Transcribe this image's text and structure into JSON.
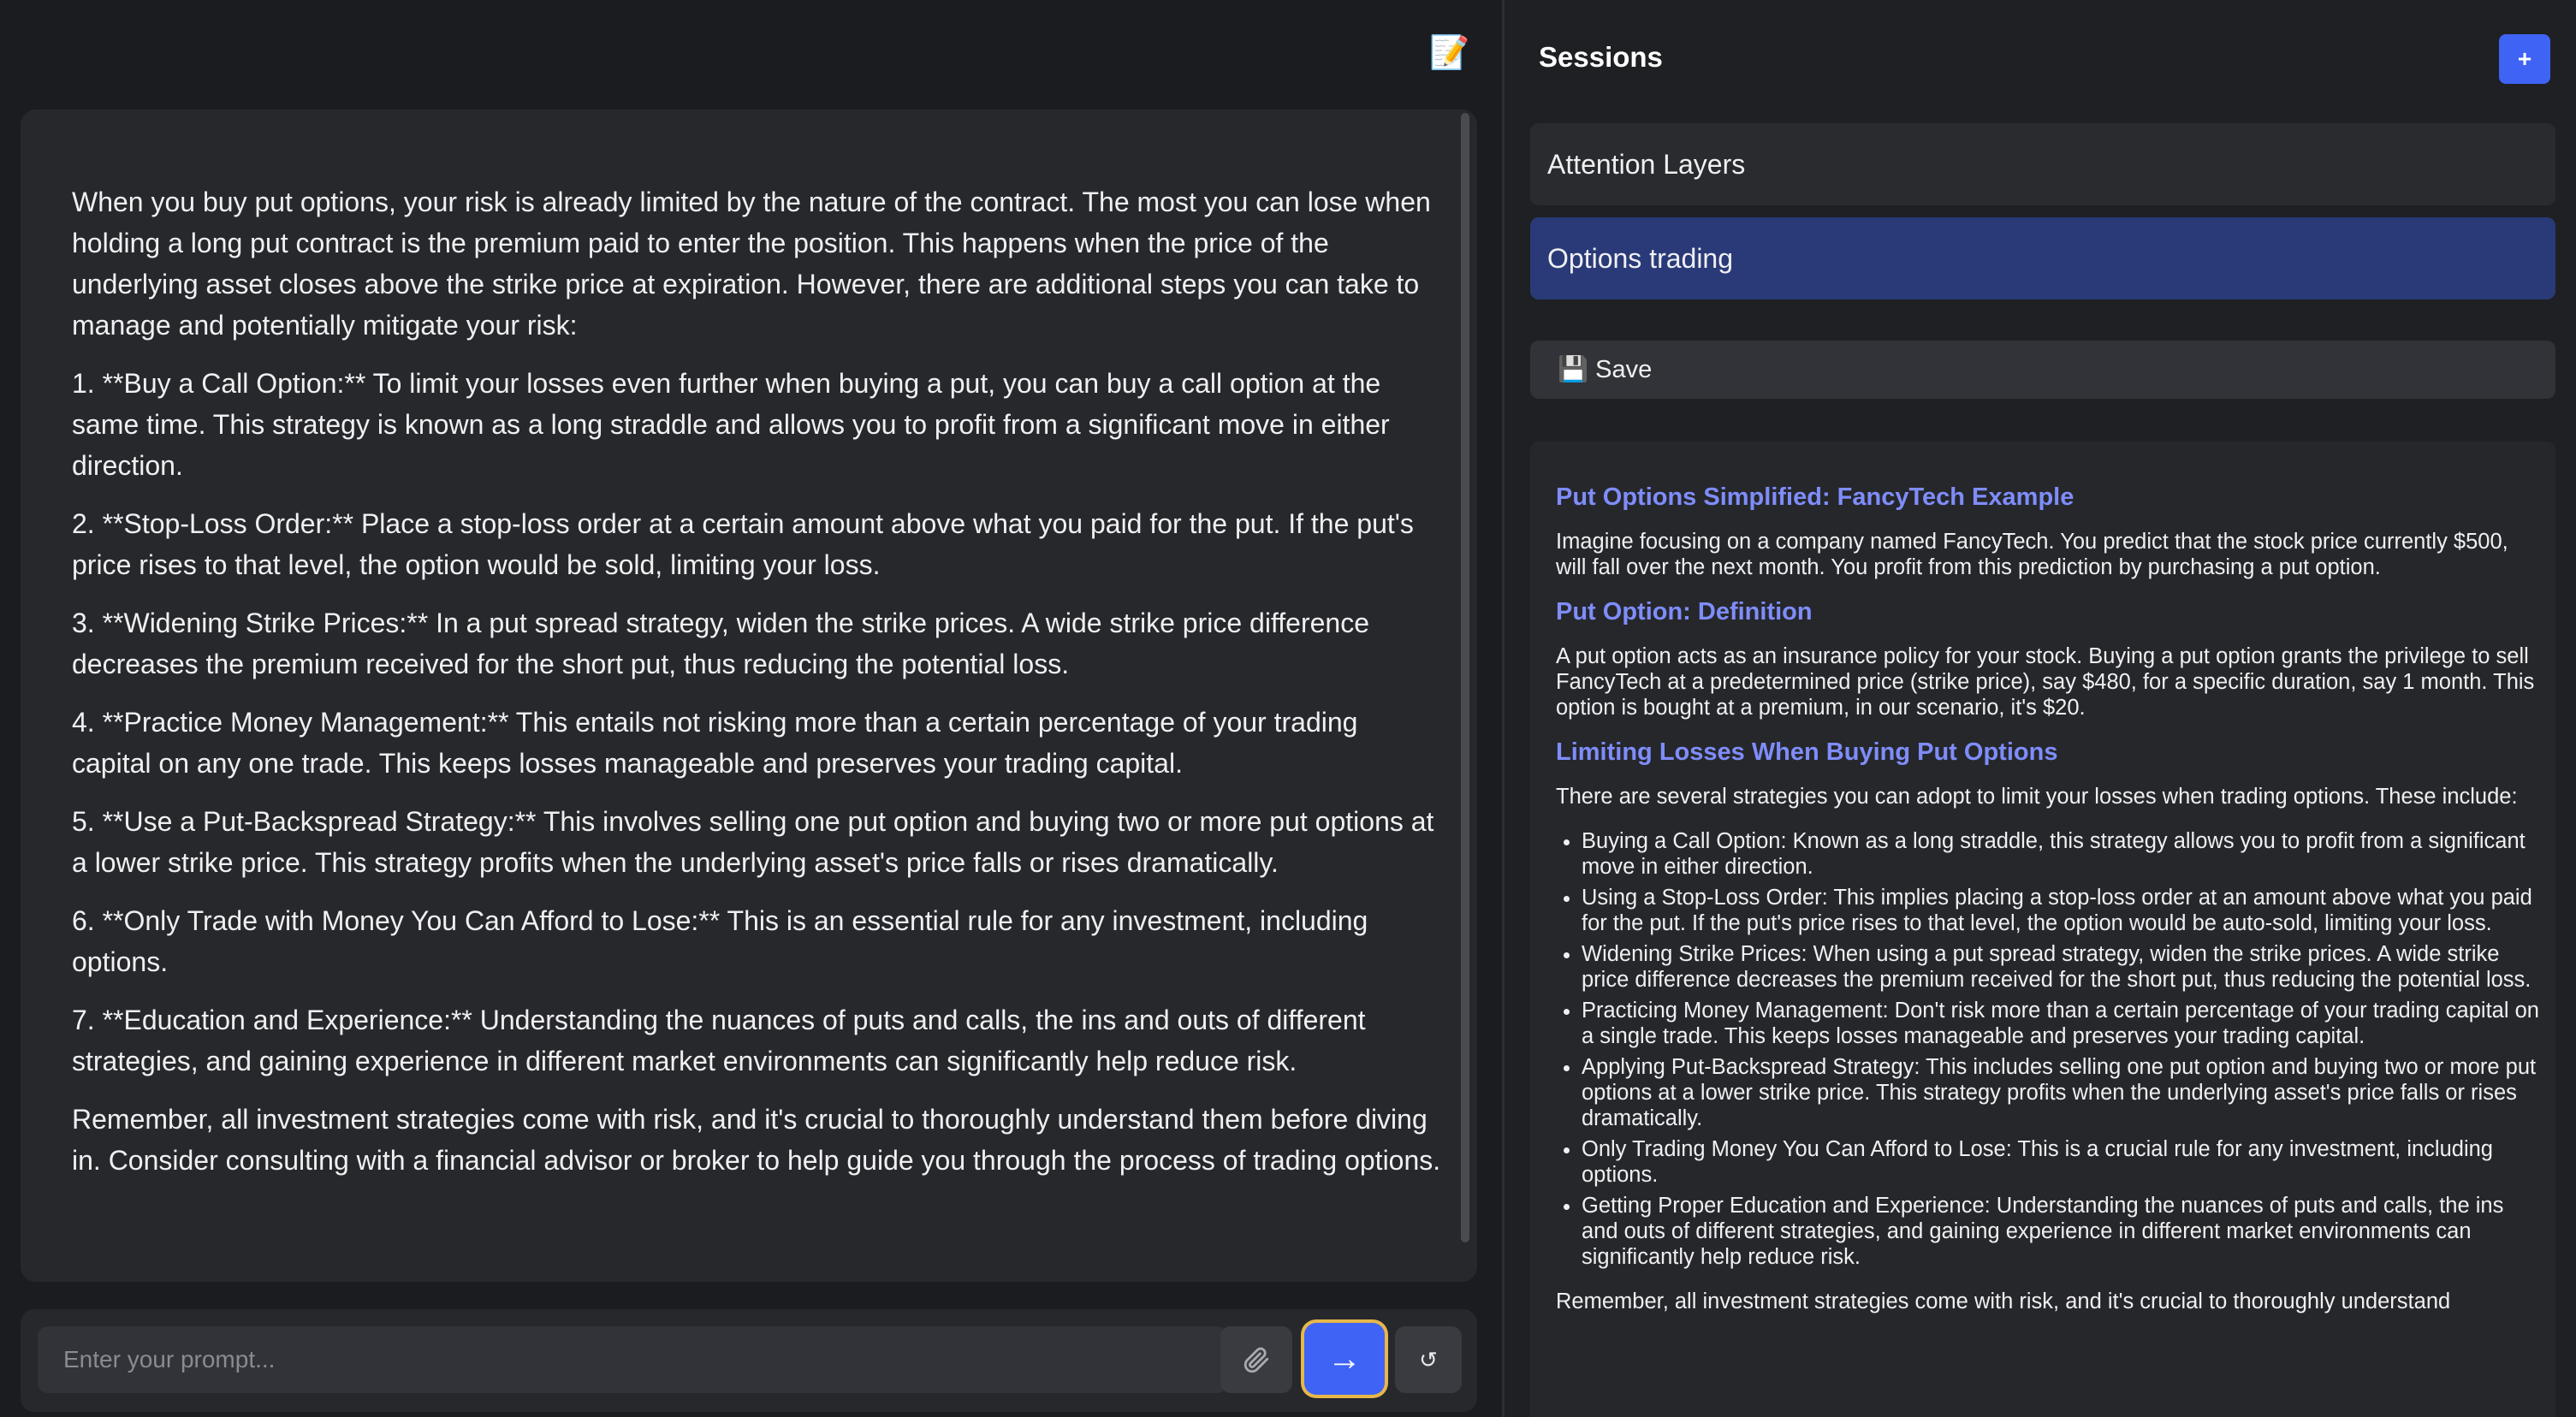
{
  "chat": {
    "paragraphs": [
      "When you buy put options, your risk is already limited by the nature of the contract. The most you can lose when holding a long put contract is the premium paid to enter the position. This happens when the price of the underlying asset closes above the strike price at expiration. However, there are additional steps you can take to manage and potentially mitigate your risk:",
      "1. **Buy a Call Option:** To limit your losses even further when buying a put, you can buy a call option at the same time. This strategy is known as a long straddle and allows you to profit from a significant move in either direction.",
      "2. **Stop-Loss Order:** Place a stop-loss order at a certain amount above what you paid for the put. If the put's price rises to that level, the option would be sold, limiting your loss.",
      "3. **Widening Strike Prices:** In a put spread strategy, widen the strike prices. A wide strike price difference decreases the premium received for the short put, thus reducing the potential loss.",
      "4. **Practice Money Management:** This entails not risking more than a certain percentage of your trading capital on any one trade. This keeps losses manageable and preserves your trading capital.",
      "5. **Use a Put-Backspread Strategy:** This involves selling one put option and buying two or more put options at a lower strike price. This strategy profits when the underlying asset's price falls or rises dramatically.",
      "6. **Only Trade with Money You Can Afford to Lose:** This is an essential rule for any investment, including options.",
      "7. **Education and Experience:** Understanding the nuances of puts and calls, the ins and outs of different strategies, and gaining experience in different market environments can significantly help reduce risk.",
      "Remember, all investment strategies come with risk, and it's crucial to thoroughly understand them before diving in. Consider consulting with a financial advisor or broker to help guide you through the process of trading options."
    ]
  },
  "input": {
    "placeholder": "Enter your prompt...",
    "value": ""
  },
  "buttons": {
    "attach_icon": "paperclip-icon",
    "send_glyph": "→",
    "reset_glyph": "↺",
    "edit_glyph": "📝"
  },
  "sidebar": {
    "title": "Sessions",
    "add_label": "+",
    "sessions": [
      {
        "label": "Attention Layers",
        "active": false
      },
      {
        "label": "Options trading",
        "active": true
      }
    ],
    "save_label": "💾 Save"
  },
  "notes": {
    "section1_title": "Put Options Simplified: FancyTech Example",
    "section1_text": "Imagine focusing on a company named FancyTech. You predict that the stock price currently $500, will fall over the next month. You profit from this prediction by purchasing a put option.",
    "section2_title": "Put Option: Definition",
    "section2_text": "A put option acts as an insurance policy for your stock. Buying a put option grants the privilege to sell FancyTech at a predetermined price (strike price), say $480, for a specific duration, say 1 month. This option is bought at a premium, in our scenario, it's $20.",
    "section3_title": "Limiting Losses When Buying Put Options",
    "section3_text": "There are several strategies you can adopt to limit your losses when trading options. These include:",
    "strategies": [
      "Buying a Call Option: Known as a long straddle, this strategy allows you to profit from a significant move in either direction.",
      "Using a Stop-Loss Order: This implies placing a stop-loss order at an amount above what you paid for the put. If the put's price rises to that level, the option would be auto-sold, limiting your loss.",
      "Widening Strike Prices: When using a put spread strategy, widen the strike prices. A wide strike price difference decreases the premium received for the short put, thus reducing the potential loss.",
      "Practicing Money Management: Don't risk more than a certain percentage of your trading capital on a single trade. This keeps losses manageable and preserves your trading capital.",
      "Applying Put-Backspread Strategy: This includes selling one put option and buying two or more put options at a lower strike price. This strategy profits when the underlying asset's price falls or rises dramatically.",
      "Only Trading Money You Can Afford to Lose: This is a crucial rule for any investment, including options.",
      "Getting Proper Education and Experience: Understanding the nuances of puts and calls, the ins and outs of different strategies, and gaining experience in different market environments can significantly help reduce risk."
    ],
    "closing_text": "Remember, all investment strategies come with risk, and it's crucial to thoroughly understand"
  }
}
